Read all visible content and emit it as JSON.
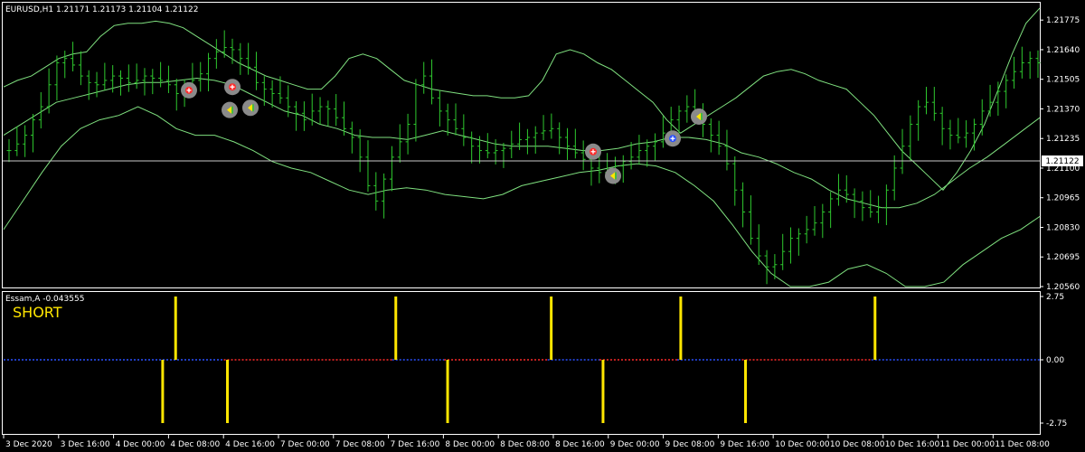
{
  "window": {
    "main_header": "EURUSD,H1  1.21171 1.21173 1.21104 1.21122",
    "indicator_header": "Essam,A -0.043555",
    "signal_text": "SHORT",
    "current_price_label": "1.21122"
  },
  "colors": {
    "background": "#000000",
    "candles": "#2ec82e",
    "bands": "#7fe07f",
    "indicator_bar": "#ffe600",
    "zero_line_up": "#2a50ff",
    "zero_line_down": "#ff2a2a",
    "grid": "#ffffff"
  },
  "chart_data": [
    {
      "type": "bar",
      "subtype": "ohlc-price-chart-with-bollinger-bands",
      "symbol": "EURUSD",
      "timeframe": "H1",
      "last_ohlc": {
        "open": 1.21171,
        "high": 1.21173,
        "low": 1.21104,
        "close": 1.21122
      },
      "current_price": 1.21122,
      "ylim": [
        1.2056,
        1.2185
      ],
      "y_ticks": [
        "1.21775",
        "1.21640",
        "1.21505",
        "1.21370",
        "1.21235",
        "1.21100",
        "1.20965",
        "1.20830",
        "1.20695",
        "1.20560"
      ],
      "x_tick_labels": [
        "3 Dec 2020",
        "3 Dec 16:00",
        "4 Dec 00:00",
        "4 Dec 08:00",
        "4 Dec 16:00",
        "7 Dec 00:00",
        "7 Dec 08:00",
        "7 Dec 16:00",
        "8 Dec 00:00",
        "8 Dec 08:00",
        "8 Dec 16:00",
        "9 Dec 00:00",
        "9 Dec 08:00",
        "9 Dec 16:00",
        "10 Dec 00:00",
        "10 Dec 08:00",
        "10 Dec 16:00",
        "11 Dec 00:00",
        "11 Dec 08:00"
      ],
      "close_series": [
        1.2118,
        1.2121,
        1.2125,
        1.2132,
        1.2138,
        1.2148,
        1.2158,
        1.216,
        1.2157,
        1.2152,
        1.2149,
        1.2148,
        1.215,
        1.2152,
        1.2151,
        1.2149,
        1.215,
        1.2152,
        1.2151,
        1.215,
        1.2148,
        1.2144,
        1.2146,
        1.215,
        1.2153,
        1.216,
        1.2163,
        1.2165,
        1.2164,
        1.216,
        1.2156,
        1.2149,
        1.2146,
        1.2144,
        1.2142,
        1.2138,
        1.2135,
        1.2132,
        1.2136,
        1.2138,
        1.2137,
        1.2133,
        1.2128,
        1.2124,
        1.2115,
        1.2102,
        1.2095,
        1.2105,
        1.2115,
        1.2122,
        1.213,
        1.2148,
        1.2152,
        1.2142,
        1.2136,
        1.2132,
        1.2128,
        1.2124,
        1.212,
        1.2118,
        1.2117,
        1.2118,
        1.2119,
        1.2121,
        1.2123,
        1.2124,
        1.2126,
        1.2127,
        1.2128,
        1.2124,
        1.212,
        1.2117,
        1.2114,
        1.211,
        1.2108,
        1.2109,
        1.2111,
        1.2113,
        1.2115,
        1.2118,
        1.212,
        1.2122,
        1.2126,
        1.2132,
        1.2136,
        1.2138,
        1.2135,
        1.213,
        1.2125,
        1.212,
        1.2112,
        1.21,
        1.209,
        1.2078,
        1.207,
        1.2065,
        1.2066,
        1.2072,
        1.2078,
        1.208,
        1.2082,
        1.2085,
        1.209,
        1.2096,
        1.21,
        1.2098,
        1.2095,
        1.2092,
        1.209,
        1.2092,
        1.21,
        1.211,
        1.212,
        1.213,
        1.2138,
        1.214,
        1.2135,
        1.2128,
        1.2125,
        1.2124,
        1.2126,
        1.213,
        1.2136,
        1.214,
        1.2145,
        1.215,
        1.2154,
        1.2158,
        1.216,
        1.2158
      ],
      "bollinger_upper": [
        1.2147,
        1.215,
        1.2152,
        1.2156,
        1.216,
        1.2162,
        1.2163,
        1.217,
        1.2175,
        1.2176,
        1.2176,
        1.2177,
        1.2176,
        1.2174,
        1.217,
        1.2166,
        1.2162,
        1.2158,
        1.2155,
        1.2152,
        1.215,
        1.2148,
        1.2146,
        1.2146,
        1.2152,
        1.216,
        1.2162,
        1.216,
        1.2155,
        1.215,
        1.2148,
        1.2146,
        1.2145,
        1.2144,
        1.2143,
        1.2143,
        1.2142,
        1.2142,
        1.2143,
        1.215,
        1.2162,
        1.2164,
        1.2162,
        1.2158,
        1.2155,
        1.215,
        1.2145,
        1.214,
        1.2132,
        1.2126,
        1.213,
        1.2134,
        1.2138,
        1.2142,
        1.2147,
        1.2152,
        1.2154,
        1.2155,
        1.2153,
        1.215,
        1.2148,
        1.2146,
        1.214,
        1.2134,
        1.2126,
        1.2118,
        1.2112,
        1.2106,
        1.21,
        1.2108,
        1.2118,
        1.213,
        1.2146,
        1.2162,
        1.2176,
        1.2183
      ],
      "bollinger_middle": [
        1.2125,
        1.213,
        1.2135,
        1.214,
        1.2142,
        1.2144,
        1.2146,
        1.2148,
        1.2149,
        1.2149,
        1.215,
        1.2151,
        1.215,
        1.2148,
        1.2144,
        1.214,
        1.2136,
        1.2134,
        1.213,
        1.2128,
        1.2125,
        1.2124,
        1.2124,
        1.2123,
        1.2125,
        1.2127,
        1.2125,
        1.2123,
        1.2121,
        1.212,
        1.212,
        1.212,
        1.2119,
        1.2118,
        1.2118,
        1.2119,
        1.2121,
        1.2122,
        1.2124,
        1.2124,
        1.2123,
        1.2121,
        1.2117,
        1.2115,
        1.2112,
        1.2108,
        1.2105,
        1.21,
        1.2096,
        1.2094,
        1.2092,
        1.2092,
        1.2094,
        1.2098,
        1.2104,
        1.211,
        1.2115,
        1.2121,
        1.2127,
        1.2133
      ],
      "bollinger_lower": [
        1.2082,
        1.2095,
        1.2108,
        1.212,
        1.2128,
        1.2132,
        1.2134,
        1.2138,
        1.2134,
        1.2128,
        1.2125,
        1.2125,
        1.2122,
        1.2118,
        1.2113,
        1.211,
        1.2108,
        1.2104,
        1.21,
        1.2098,
        1.21,
        1.2101,
        1.21,
        1.2098,
        1.2097,
        1.2096,
        1.2098,
        1.2102,
        1.2104,
        1.2106,
        1.2108,
        1.2109,
        1.2111,
        1.2112,
        1.2111,
        1.2108,
        1.2102,
        1.2095,
        1.2084,
        1.2072,
        1.2062,
        1.2054,
        1.2052,
        1.2058,
        1.2064,
        1.2066,
        1.2062,
        1.2056,
        1.2054,
        1.2058,
        1.2066,
        1.2072,
        1.2078,
        1.2082,
        1.2088
      ],
      "signals": [
        {
          "kind": "sell-entry",
          "price": 1.21455
        },
        {
          "kind": "sell-entry",
          "price": 1.2147
        },
        {
          "kind": "exit",
          "price": 1.21365
        },
        {
          "kind": "exit",
          "price": 1.21375
        },
        {
          "kind": "sell-entry",
          "price": 1.21175
        },
        {
          "kind": "exit",
          "price": 1.21065
        },
        {
          "kind": "buy-entry",
          "price": 1.21235
        },
        {
          "kind": "exit",
          "price": 1.21335
        }
      ]
    },
    {
      "type": "bar",
      "subtype": "indicator-histogram",
      "name": "Essam,A",
      "current_value": -0.043555,
      "ylim": [
        -2.75,
        2.75
      ],
      "y_ticks": [
        "2.75",
        "0.00",
        "-2.75"
      ],
      "bars": [
        {
          "x_index": 12,
          "value": -2.75
        },
        {
          "x_index": 13,
          "value": 2.75
        },
        {
          "x_index": 17,
          "value": -2.75
        },
        {
          "x_index": 30,
          "value": 2.75
        },
        {
          "x_index": 34,
          "value": -2.75
        },
        {
          "x_index": 42,
          "value": 2.75
        },
        {
          "x_index": 46,
          "value": -2.75
        },
        {
          "x_index": 52,
          "value": 2.75
        },
        {
          "x_index": 57,
          "value": -2.75
        },
        {
          "x_index": 67,
          "value": 2.75
        }
      ],
      "zero_line_segments": [
        {
          "from_index": 0,
          "to_index": 17,
          "color": "blue"
        },
        {
          "from_index": 17,
          "to_index": 30,
          "color": "red"
        },
        {
          "from_index": 30,
          "to_index": 34,
          "color": "blue"
        },
        {
          "from_index": 34,
          "to_index": 42,
          "color": "red"
        },
        {
          "from_index": 42,
          "to_index": 46,
          "color": "blue"
        },
        {
          "from_index": 46,
          "to_index": 52,
          "color": "red"
        },
        {
          "from_index": 52,
          "to_index": 57,
          "color": "blue"
        },
        {
          "from_index": 57,
          "to_index": 67,
          "color": "red"
        },
        {
          "from_index": 67,
          "to_index": 80,
          "color": "blue"
        }
      ]
    }
  ]
}
